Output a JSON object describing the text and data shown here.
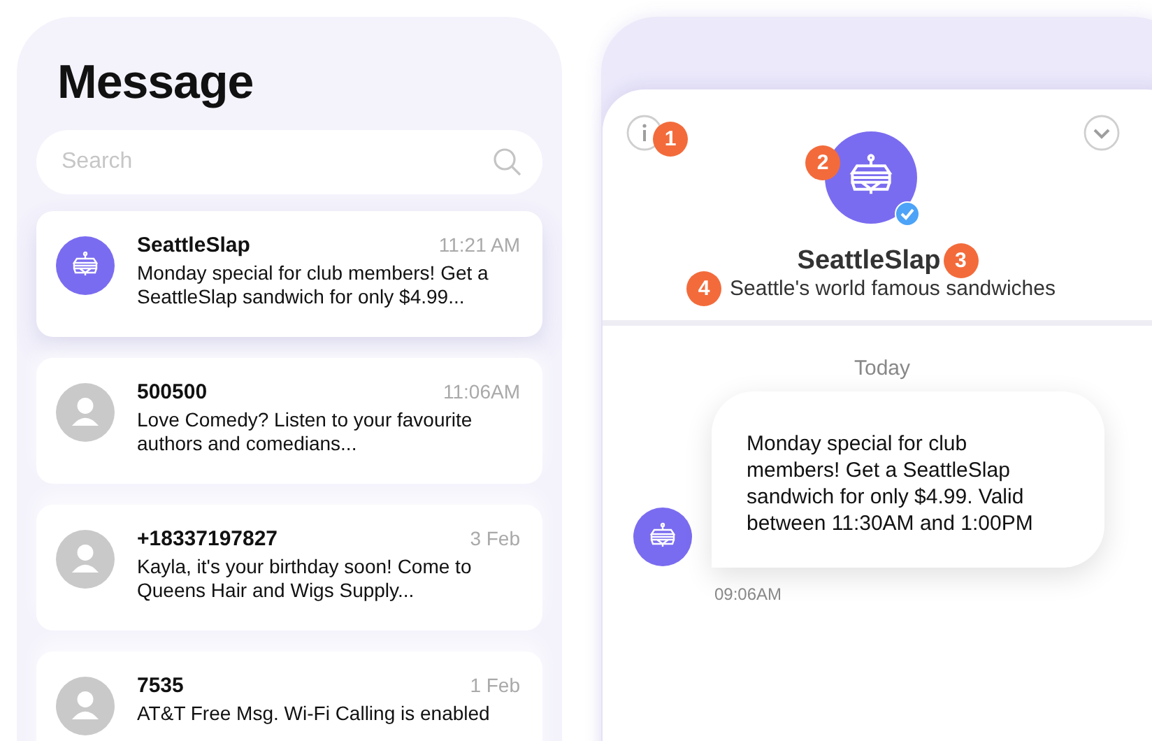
{
  "inbox": {
    "title": "Message",
    "search": {
      "placeholder": "Search"
    },
    "conversations": [
      {
        "sender": "SeattleSlap",
        "time": "11:21 AM",
        "preview": "Monday special for club members! Get a SeattleSlap sandwich for only $4.99...",
        "kind": "brand",
        "selected": true
      },
      {
        "sender": "500500",
        "time": "11:06AM",
        "preview": "Love Comedy? Listen to your favourite authors and comedians...",
        "kind": "person",
        "selected": false
      },
      {
        "sender": "+18337197827",
        "time": "3 Feb",
        "preview": "Kayla, it's your birthday soon! Come to Queens Hair and Wigs Supply...",
        "kind": "person",
        "selected": false
      },
      {
        "sender": "7535",
        "time": "1 Feb",
        "preview": "AT&T Free Msg. Wi-Fi Calling is enabled",
        "kind": "person",
        "selected": false
      }
    ]
  },
  "conversation": {
    "name": "SeattleSlap",
    "verified": true,
    "tagline": "Seattle's world famous sandwiches",
    "markers": [
      "1",
      "2",
      "3",
      "4"
    ],
    "date_divider": "Today",
    "messages": [
      {
        "text": "Monday special for club members! Get a SeattleSlap sandwich for only $4.99. Valid between 11:30AM and 1:00PM",
        "time": "09:06AM"
      }
    ]
  }
}
